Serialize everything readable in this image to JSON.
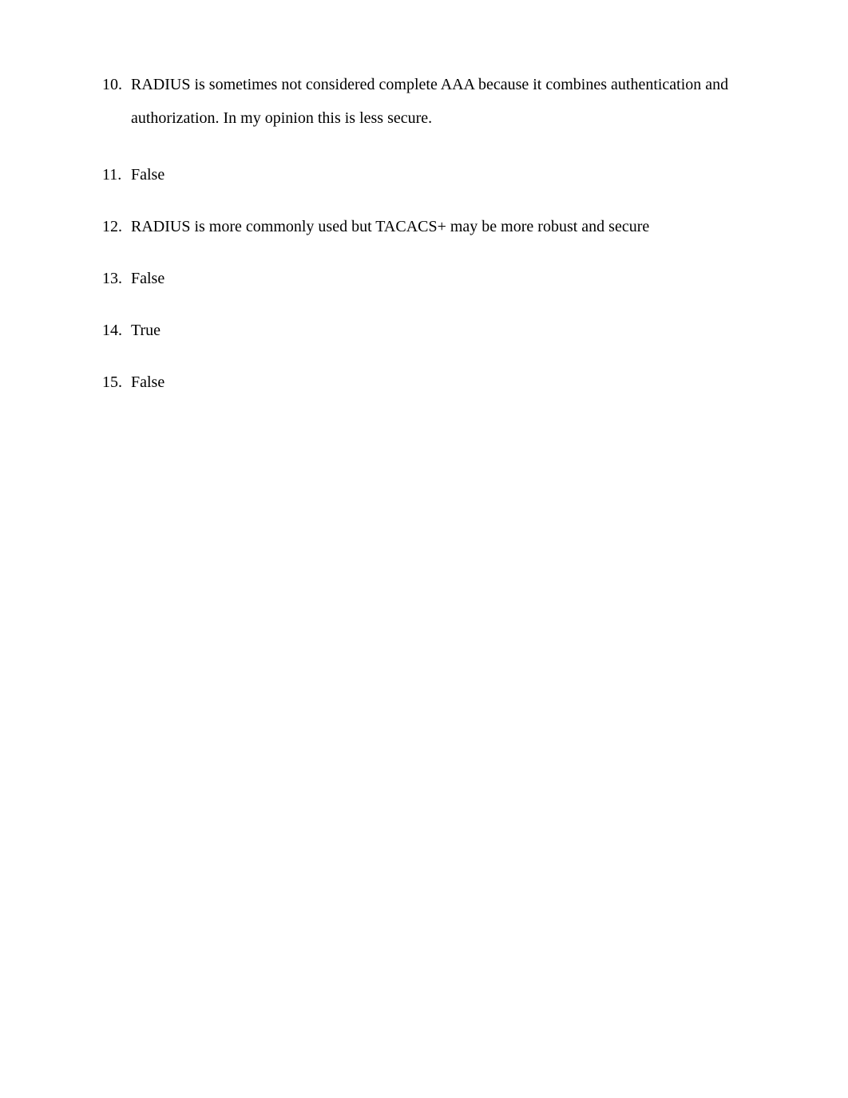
{
  "items": [
    {
      "number": "10.",
      "text": "RADIUS is sometimes not considered complete AAA because it combines authentication and authorization. In my opinion this is less secure."
    },
    {
      "number": "11.",
      "text": "False"
    },
    {
      "number": "12.",
      "text": "RADIUS is more commonly used but TACACS+ may be more robust and secure"
    },
    {
      "number": "13.",
      "text": "False"
    },
    {
      "number": "14.",
      "text": "True"
    },
    {
      "number": "15.",
      "text": "False"
    }
  ]
}
